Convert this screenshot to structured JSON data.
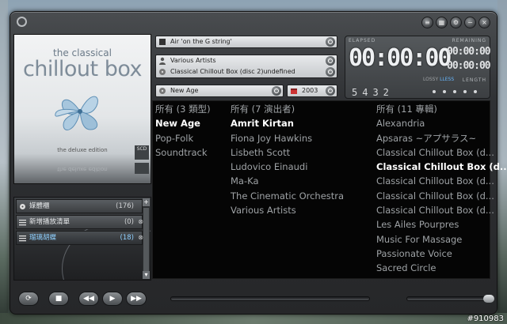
{
  "info": {
    "track": "Air 'on the G string'",
    "artist": "Various Artists",
    "album": "Classical Chillout Box (disc 2)undefined",
    "genre": "New Age",
    "year": "2003"
  },
  "album_art": {
    "line1": "the classical",
    "line2": "chillout box",
    "edition": "the deluxe edition",
    "reflection": "the deluxe edition",
    "badge": "SCD"
  },
  "display": {
    "elapsed_label": "ELAPSED",
    "remaining_label": "REMAINING",
    "length_label": "LENGTH",
    "time": "00:00:00",
    "remaining": "00:00:00",
    "length": "00:00:00",
    "lossy": "LOSSY",
    "lossless": "LLESS",
    "numbers": "5432"
  },
  "browser": {
    "genres": {
      "header": "所有 (3 類型)",
      "items": [
        "New Age",
        "Pop-Folk",
        "Soundtrack"
      ],
      "selected": 0
    },
    "artists": {
      "header": "所有 (7 演出者)",
      "items": [
        "Amrit Kirtan",
        "Fiona Joy Hawkins",
        "Lisbeth Scott",
        "Ludovico Einaudi",
        "Ma-Ka",
        "The Cinematic Orchestra",
        "Various Artists"
      ],
      "selected": 0
    },
    "albums": {
      "header": "所有 (11 專輯)",
      "items": [
        "Alexandria",
        "Apsaras ~アプサラス~",
        "Classical Chillout Box (d...",
        "Classical Chillout Box (d...",
        "Classical Chillout Box (d...",
        "Classical Chillout Box (d...",
        "Classical Chillout Box (d...",
        "Les Ailes Pourpres",
        "Music For Massage",
        "Passionate Voice",
        "Sacred Circle"
      ],
      "selected": 3
    }
  },
  "playlists": [
    {
      "name": "媒體櫃",
      "count": "(176)",
      "active": false
    },
    {
      "name": "新增播放清單",
      "count": "(0)",
      "active": false
    },
    {
      "name": "瑠璃胡蝶",
      "count": "(18)",
      "active": true
    }
  ],
  "watermark": "#910983",
  "colors": {
    "accent": "#67b7ff",
    "selected_text": "#ffffff",
    "muted_text": "#9ea2a5",
    "browser_bg": "#050505"
  }
}
